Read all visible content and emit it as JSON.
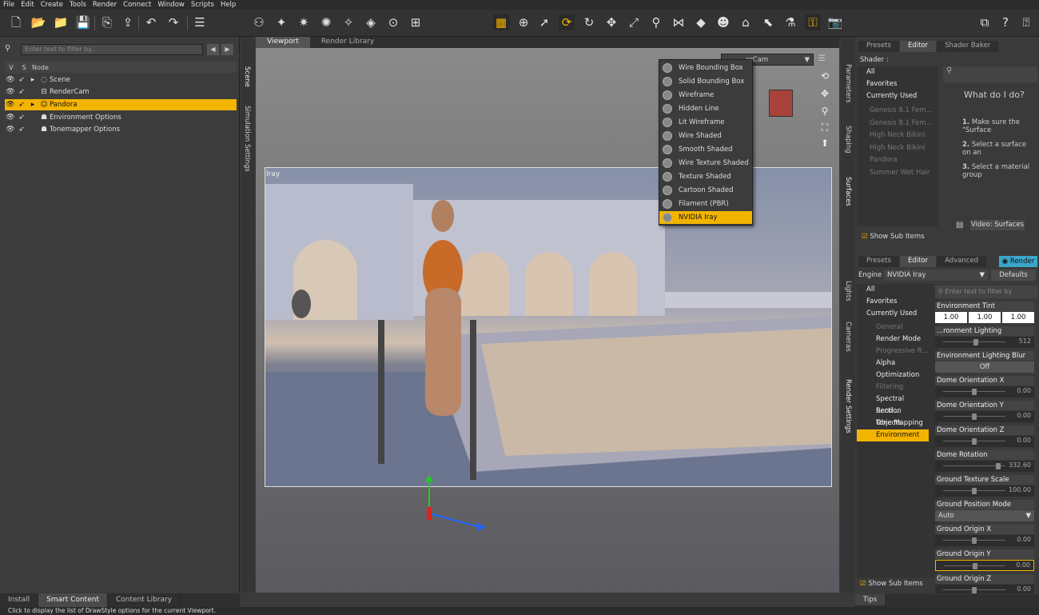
{
  "menu": [
    "File",
    "Edit",
    "Create",
    "Tools",
    "Render",
    "Connect",
    "Window",
    "Scripts",
    "Help"
  ],
  "scene": {
    "filter_placeholder": "Enter text to filter by...",
    "col_v": "V",
    "col_s": "S",
    "col_node": "Node",
    "side_tabs": [
      "Scene",
      "Simulation Settings"
    ],
    "nodes": [
      {
        "label": "Scene",
        "selected": false
      },
      {
        "label": "RenderCam",
        "selected": false
      },
      {
        "label": "Pandora",
        "selected": true
      },
      {
        "label": "Environment Options",
        "selected": false
      },
      {
        "label": "Tonemapper Options",
        "selected": false
      }
    ]
  },
  "bottom_tabs": [
    "Install",
    "Smart Content",
    "Content Library"
  ],
  "status_text": "Click to display the list of DrawStyle options for the current Viewport.",
  "viewport": {
    "tabs": [
      "Viewport",
      "Render Library"
    ],
    "camera": "RenderCam",
    "camera_visible": "erCam",
    "overlay_label": "Iray",
    "draw_styles": [
      "Wire Bounding Box",
      "Solid Bounding Box",
      "Wireframe",
      "Hidden Line",
      "Lit Wireframe",
      "Wire Shaded",
      "Smooth Shaded",
      "Wire Texture Shaded",
      "Texture Shaded",
      "Cartoon Shaded",
      "Filament (PBR)",
      "NVIDIA Iray"
    ],
    "selected_draw_style": "NVIDIA Iray"
  },
  "right_side_tabs_top": [
    "Parameters",
    "Shaping",
    "Surfaces"
  ],
  "right_side_tabs_bottom": [
    "Lights",
    "Cameras",
    "Render Settings"
  ],
  "surfaces": {
    "tabs": [
      "Presets",
      "Editor",
      "Shader Baker"
    ],
    "shader_label": "Shader :",
    "categories": [
      "All",
      "Favorites",
      "Currently Used"
    ],
    "tree": [
      "Genesis 8.1 Fem...",
      "Genesis 8.1 Fem...",
      "High Neck Bikini",
      "High Neck Bikini",
      "Pandora",
      "Summer Wet Hair"
    ],
    "help_title": "What do I do?",
    "steps": [
      {
        "n": "1.",
        "text": "Make sure the \"Surface"
      },
      {
        "n": "2.",
        "text": "Select a surface on an"
      },
      {
        "n": "3.",
        "text": "Select a material group"
      }
    ],
    "video_button": "Video: Surfaces",
    "show_sub_items": "Show Sub Items"
  },
  "render_settings": {
    "tabs": [
      "Presets",
      "Editor",
      "Advanced"
    ],
    "render_button": "Render",
    "engine_label": "Engine :",
    "engine_value": "NVIDIA Iray",
    "defaults_button": "Defaults",
    "filter_placeholder": "Enter text to filter by",
    "categories": [
      "All",
      "Favorites",
      "Currently Used"
    ],
    "groups": [
      {
        "label": "General",
        "dim": true
      },
      {
        "label": "Render Mode",
        "dim": false
      },
      {
        "label": "Progressive R...",
        "dim": true
      },
      {
        "label": "Alpha",
        "dim": false
      },
      {
        "label": "Optimization",
        "dim": false
      },
      {
        "label": "Filtering",
        "dim": true
      },
      {
        "label": "Spectral Rend...",
        "dim": false
      },
      {
        "label": "Section Objects",
        "dim": false
      },
      {
        "label": "Tone Mapping",
        "dim": false
      },
      {
        "label": "Environment",
        "dim": false,
        "selected": true
      }
    ],
    "tint": {
      "label": "Environment Tint",
      "r": "1.00",
      "g": "1.00",
      "b": "1.00"
    },
    "lighting_resolution": {
      "label": "...ronment Lighting Resolution",
      "value": "512"
    },
    "lighting_blur": {
      "label": "Environment Lighting Blur",
      "value": "Off"
    },
    "sliders": [
      {
        "label": "Dome Orientation X",
        "value": "0.00",
        "fraction": 0.5
      },
      {
        "label": "Dome Orientation Y",
        "value": "0.00",
        "fraction": 0.5
      },
      {
        "label": "Dome Orientation Z",
        "value": "0.00",
        "fraction": 0.5
      },
      {
        "label": "Dome Rotation",
        "value": "332.60",
        "fraction": 0.92
      },
      {
        "label": "Ground Texture Scale",
        "value": "100.00",
        "fraction": 0.5
      }
    ],
    "ground_mode": {
      "label": "Ground Position Mode",
      "value": "Auto"
    },
    "ground_sliders": [
      {
        "label": "Ground Origin X",
        "value": "0.00",
        "fraction": 0.5
      },
      {
        "label": "Ground Origin Y",
        "value": "0.00",
        "fraction": 0.5,
        "highlight": true
      },
      {
        "label": "Ground Origin Z",
        "value": "0.00",
        "fraction": 0.5
      }
    ],
    "show_sub_items": "Show Sub Items",
    "tips_tab": "Tips"
  },
  "colors": {
    "accent": "#f3b400",
    "panel": "#3a3a3a",
    "dark": "#2b2b2b"
  }
}
